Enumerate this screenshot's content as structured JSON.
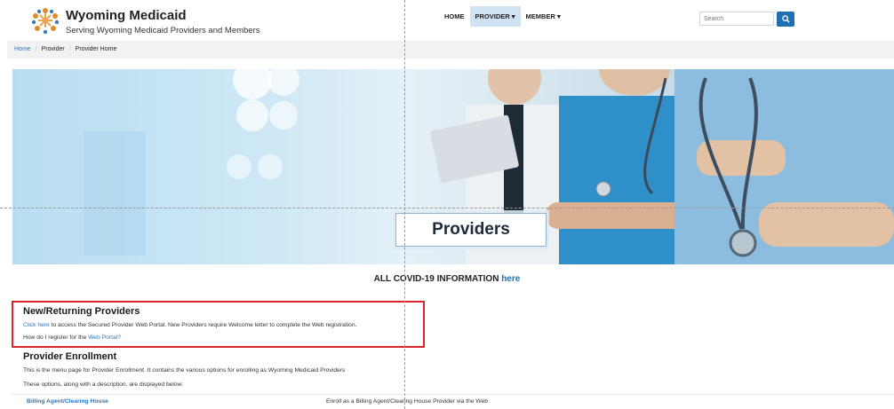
{
  "brand": {
    "title": "Wyoming Medicaid",
    "subtitle": "Serving Wyoming Medicaid Providers and Members"
  },
  "nav": {
    "items": [
      "HOME",
      "PROVIDER ▾",
      "MEMBER ▾"
    ],
    "active_index": 1
  },
  "search": {
    "placeholder": "Search"
  },
  "breadcrumb": {
    "home": "Home",
    "provider": "Provider",
    "current": "Provider Home"
  },
  "hero": {
    "title": "Providers"
  },
  "covid": {
    "text": "ALL COVID-19 INFORMATION",
    "link": "here"
  },
  "returning": {
    "heading": "New/Returning Providers",
    "click_link": "Click here",
    "click_text": "to access the Secured Provider Web Portal. New Providers require Welcome letter to complete the Web registration.",
    "register_text": "How do I register for the",
    "register_link": "Web Portal?"
  },
  "enrollment": {
    "heading": "Provider Enrollment",
    "desc1": "This is the menu page for Provider Enrollment. It contains the various options for enrolling as Wyoming Medicaid Providers",
    "desc2": "These options, along with a description, are displayed below:",
    "rows": [
      {
        "name": "Billing Agent/Clearing House",
        "description": "Enroll as a Billing Agent/Clearing House Provider via the Web"
      }
    ]
  },
  "colors": {
    "accent": "#1f6fb3",
    "highlight_box": "#d9262a"
  }
}
